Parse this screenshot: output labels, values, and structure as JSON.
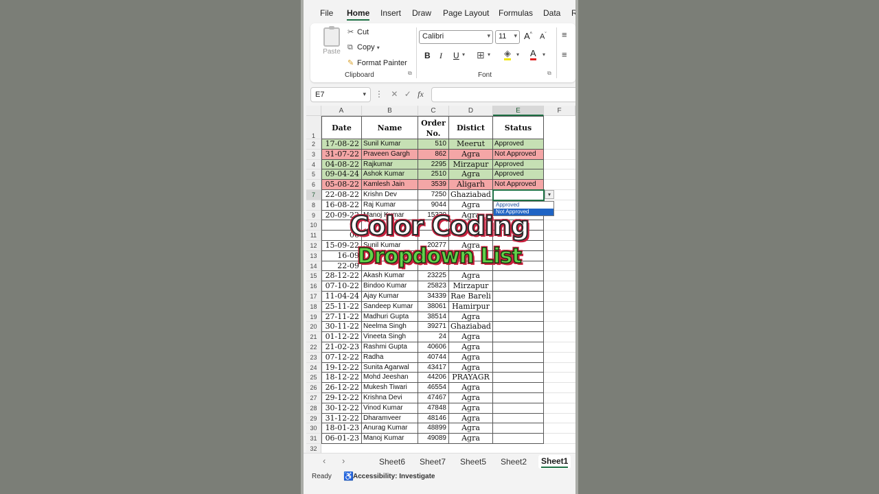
{
  "menu": {
    "tabs": [
      "File",
      "Home",
      "Insert",
      "Draw",
      "Page Layout",
      "Formulas",
      "Data",
      "R"
    ],
    "active": "Home"
  },
  "ribbon": {
    "paste_label": "Paste",
    "cut_label": "Cut",
    "copy_label": "Copy",
    "format_painter_label": "Format Painter",
    "clipboard_group": "Clipboard",
    "font_name": "Calibri",
    "font_size": "11",
    "font_group": "Font",
    "bold": "B",
    "italic": "I",
    "underline": "U",
    "grow": "A",
    "shrink": "A"
  },
  "formula_bar": {
    "name_box": "E7",
    "fx": "fx",
    "value": ""
  },
  "columns": [
    "A",
    "B",
    "C",
    "D",
    "E",
    "F"
  ],
  "selected_column": "E",
  "headers": {
    "date": "Date",
    "name": "Name",
    "order_line1": "Order",
    "order_line2": "No.",
    "district": "Distict",
    "status": "Status"
  },
  "rows": [
    {
      "n": "2",
      "date": "17-08-22",
      "name": "Sunil Kumar",
      "order": "510",
      "district": "Meerut",
      "status": "Approved"
    },
    {
      "n": "3",
      "date": "31-07-22",
      "name": "Praveen Gargh",
      "order": "862",
      "district": "Agra",
      "status": "Not Approved"
    },
    {
      "n": "4",
      "date": "04-08-22",
      "name": "Rajkumar",
      "order": "2295",
      "district": "Mirzapur",
      "status": "Approved"
    },
    {
      "n": "5",
      "date": "09-04-24",
      "name": "Ashok Kumar",
      "order": "2510",
      "district": "Agra",
      "status": "Approved"
    },
    {
      "n": "6",
      "date": "05-08-22",
      "name": "Kamlesh Jain",
      "order": "3539",
      "district": "Aligarh",
      "status": "Not Approved"
    },
    {
      "n": "7",
      "date": "22-08-22",
      "name": "Krishn Dev",
      "order": "7250",
      "district": "Ghaziabad",
      "status": ""
    },
    {
      "n": "8",
      "date": "16-08-22",
      "name": "Raj Kumar",
      "order": "9044",
      "district": "Agra",
      "status": ""
    },
    {
      "n": "9",
      "date": "20-09-22",
      "name": "Manoj Kumar",
      "order": "15330",
      "district": "Agra",
      "status": ""
    },
    {
      "n": "10",
      "date": "02",
      "name": "",
      "order": "",
      "district": "",
      "status": ""
    },
    {
      "n": "11",
      "date": "06",
      "name": "",
      "order": "",
      "district": "",
      "status": ""
    },
    {
      "n": "12",
      "date": "15-09-22",
      "name": "Sunil Kumar",
      "order": "20277",
      "district": "Agra",
      "status": ""
    },
    {
      "n": "13",
      "date": "16-09",
      "name": "",
      "order": "",
      "district": "",
      "status": ""
    },
    {
      "n": "14",
      "date": "22-09",
      "name": "",
      "order": "",
      "district": "",
      "status": ""
    },
    {
      "n": "15",
      "date": "28-12-22",
      "name": "Akash Kumar",
      "order": "23225",
      "district": "Agra",
      "status": ""
    },
    {
      "n": "16",
      "date": "07-10-22",
      "name": "Bindoo Kumar",
      "order": "25823",
      "district": "Mirzapur",
      "status": ""
    },
    {
      "n": "17",
      "date": "11-04-24",
      "name": "Ajay Kumar",
      "order": "34339",
      "district": "Rae Bareli",
      "status": ""
    },
    {
      "n": "18",
      "date": "25-11-22",
      "name": "Sandeep Kumar",
      "order": "38061",
      "district": "Hamirpur",
      "status": ""
    },
    {
      "n": "19",
      "date": "27-11-22",
      "name": "Madhuri Gupta",
      "order": "38514",
      "district": "Agra",
      "status": ""
    },
    {
      "n": "20",
      "date": "30-11-22",
      "name": "Neelma Singh",
      "order": "39271",
      "district": "Ghaziabad",
      "status": ""
    },
    {
      "n": "21",
      "date": "01-12-22",
      "name": "Vineeta Singh",
      "order": "24",
      "district": "Agra",
      "status": ""
    },
    {
      "n": "22",
      "date": "21-02-23",
      "name": "Rashmi Gupta",
      "order": "40606",
      "district": "Agra",
      "status": ""
    },
    {
      "n": "23",
      "date": "07-12-22",
      "name": "Radha",
      "order": "40744",
      "district": "Agra",
      "status": ""
    },
    {
      "n": "24",
      "date": "19-12-22",
      "name": "Sunita Agarwal",
      "order": "43417",
      "district": "Agra",
      "status": ""
    },
    {
      "n": "25",
      "date": "18-12-22",
      "name": "Mohd Jeeshan",
      "order": "44206",
      "district": "PRAYAGR",
      "status": ""
    },
    {
      "n": "26",
      "date": "26-12-22",
      "name": "Mukesh Tiwari",
      "order": "46554",
      "district": "Agra",
      "status": ""
    },
    {
      "n": "27",
      "date": "29-12-22",
      "name": "Krishna Devi",
      "order": "47467",
      "district": "Agra",
      "status": ""
    },
    {
      "n": "28",
      "date": "30-12-22",
      "name": "Vinod Kumar",
      "order": "47848",
      "district": "Agra",
      "status": ""
    },
    {
      "n": "29",
      "date": "31-12-22",
      "name": "Dharamveer",
      "order": "48146",
      "district": "Agra",
      "status": ""
    },
    {
      "n": "30",
      "date": "18-01-23",
      "name": "Anurag Kumar",
      "order": "48899",
      "district": "Agra",
      "status": ""
    },
    {
      "n": "31",
      "date": "06-01-23",
      "name": "Manoj Kumar",
      "order": "49089",
      "district": "Agra",
      "status": ""
    }
  ],
  "header_row_number": "1",
  "last_row_number": "32",
  "dropdown": {
    "options": [
      "Approved",
      "Not Approved"
    ],
    "highlighted": "Not Approved"
  },
  "overlay": {
    "line1": "Color Coding",
    "line2": "Dropdown List"
  },
  "sheet_tabs": [
    "Sheet6",
    "Sheet7",
    "Sheet5",
    "Sheet2",
    "Sheet1"
  ],
  "active_sheet": "Sheet1",
  "status_bar": {
    "ready": "Ready",
    "accessibility": "Accessibility: Investigate"
  },
  "colors": {
    "approved_fill": "#c6e0b4",
    "not_approved_fill": "#f4a6a6",
    "excel_green": "#1e7145",
    "dropdown_highlight": "#1f64c4"
  }
}
